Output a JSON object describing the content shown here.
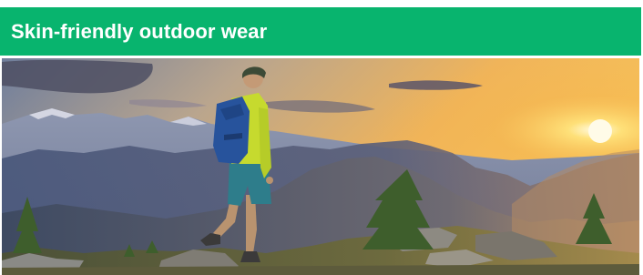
{
  "banner": {
    "title": "Skin-friendly outdoor wear",
    "background_color": "#08b46e",
    "text_color": "#ffffff"
  },
  "hero": {
    "image_icon": "hiker-mountain-sunset-photo"
  }
}
